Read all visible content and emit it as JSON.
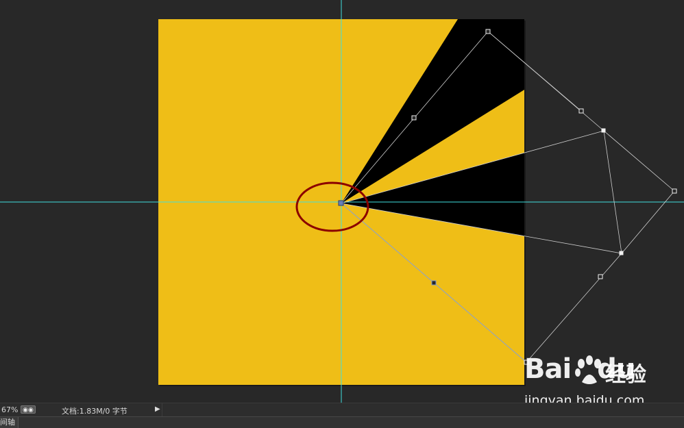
{
  "status_bar": {
    "zoom": "67%",
    "doc_info": "文档:1.83M/0 字节",
    "arrow": "▶"
  },
  "timeline": {
    "tab_label": "间轴"
  },
  "watermark": {
    "brand_latin": "Bai",
    "brand_latin_tail": "du",
    "brand_cn": "经验",
    "url": "jingyan.baidu.com"
  },
  "colors": {
    "workspace": "#282828",
    "document": "#efbe17",
    "ray": "#000000",
    "guide": "#3fe0e0",
    "highlight_ellipse": "#8b0000",
    "path": "#cccccc"
  },
  "icons": {
    "zoom_toggle": "link-icon",
    "status_arrow": "play-arrow-icon",
    "anchor": "anchor-point-icon",
    "logo": "paw-icon"
  }
}
